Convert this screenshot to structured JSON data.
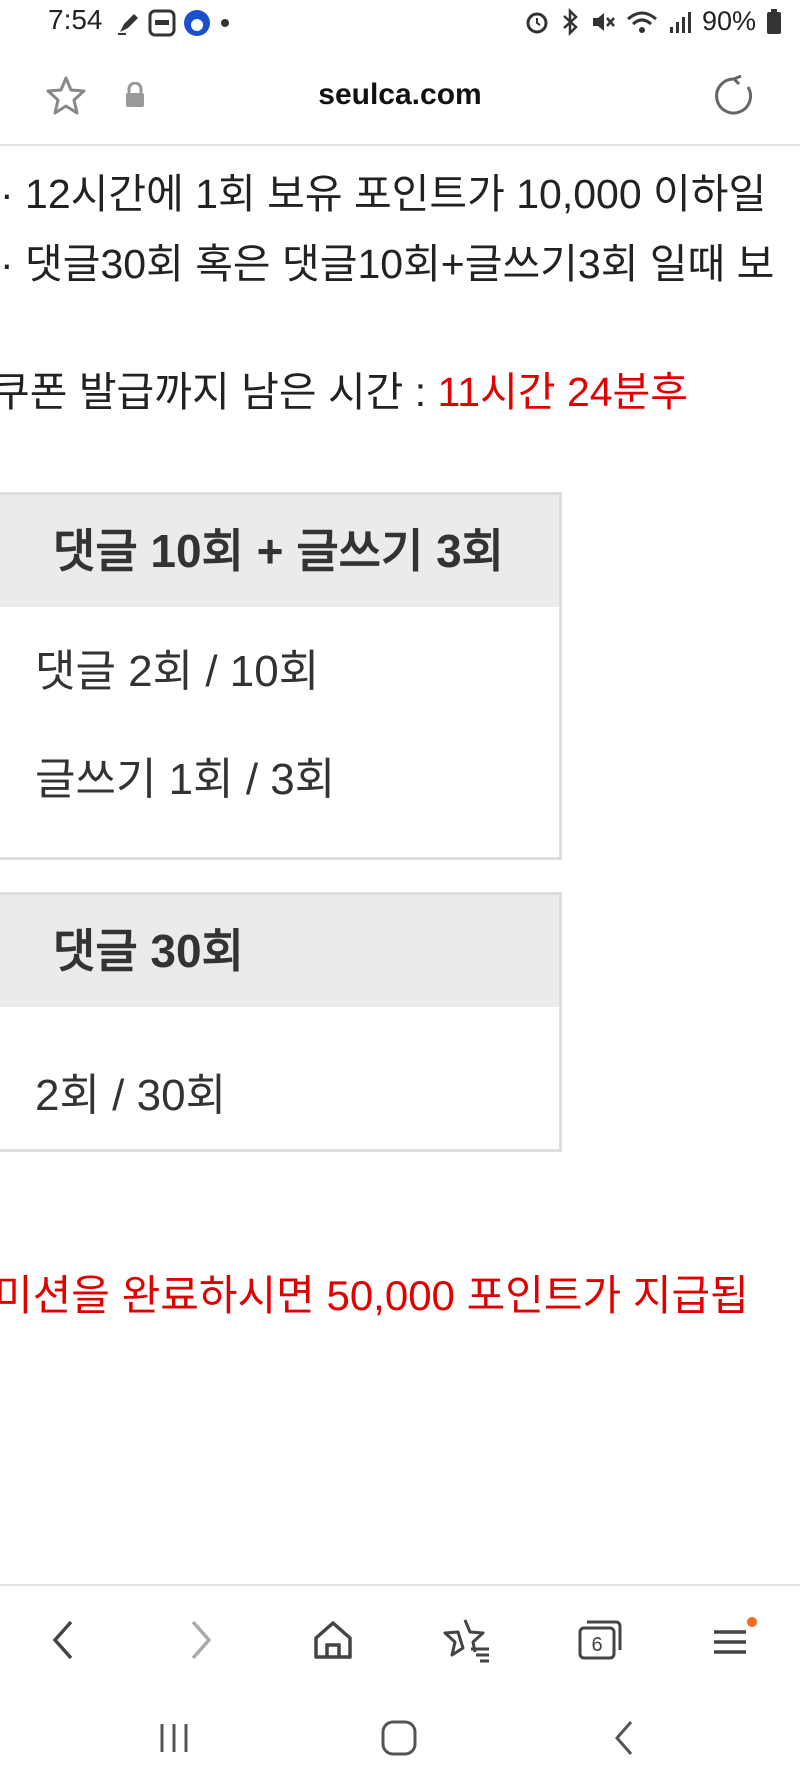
{
  "status_bar": {
    "time": "7:54",
    "battery": "90%",
    "left_icons": [
      "pen-icon",
      "app-badge-icon",
      "super-sol-icon",
      "dot-icon"
    ],
    "right_icons": [
      "alarm-icon",
      "bluetooth-icon",
      "mute-icon",
      "wifi-icon",
      "signal-icon",
      "battery-icon"
    ]
  },
  "browser": {
    "url": "seulca.com"
  },
  "content": {
    "rule_1": "· 12시간에 1회 보유 포인트가 10,000 이하일",
    "rule_2": "· 댓글30회 혹은 댓글10회+글쓰기3회 일때 보",
    "countdown_label": "쿠폰 발급까지 남은 시간 : ",
    "countdown_value": "11시간 24분후",
    "mission_1": {
      "title": "댓글 10회 + 글쓰기 3회",
      "comments": "댓글 2회 / 10회",
      "posts": "글쓰기 1회 / 3회"
    },
    "mission_2": {
      "title": "댓글 30회",
      "comments": "2회 / 30회"
    },
    "reward_notice": "미션을 완료하시면 50,000 포인트가 지급됩"
  },
  "bottom_nav": {
    "tabs_count": "6"
  },
  "colors": {
    "accent_red": "#e00000",
    "menu_badge": "#f26b21"
  }
}
